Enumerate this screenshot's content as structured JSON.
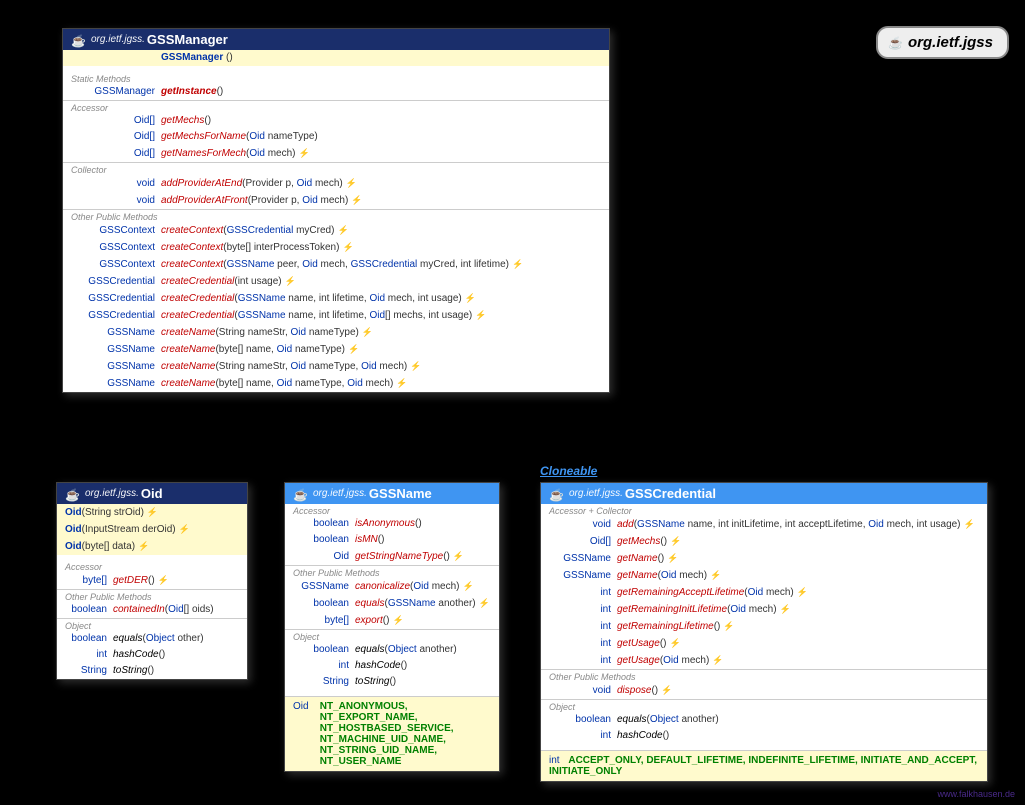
{
  "package_badge": "org.ietf.jgss",
  "footer": "www.falkhausen.de",
  "cloneable_label": "Cloneable",
  "cards": {
    "gssmanager": {
      "pkg": "org.ietf.jgss.",
      "name": "GSSManager",
      "constructor": "GSSManager",
      "sections": {
        "static": "Static Methods",
        "accessor": "Accessor",
        "collector": "Collector",
        "other": "Other Public Methods"
      },
      "static_methods": [
        {
          "ret": "GSSManager",
          "name": "getInstance",
          "args": "()"
        }
      ],
      "accessor": [
        {
          "ret": "Oid[]",
          "name": "getMechs",
          "args": "()"
        },
        {
          "ret": "Oid[]",
          "name": "getMechsForName",
          "args_pre": "(",
          "t1": "Oid",
          "a1": " nameType)",
          "args_post": ""
        },
        {
          "ret": "Oid[]",
          "name": "getNamesForMech",
          "args_pre": "(",
          "t1": "Oid",
          "a1": " mech)",
          "throws": "⚡"
        }
      ],
      "collector": [
        {
          "ret": "void",
          "name": "addProviderAtEnd",
          "html": "(Provider p, <span class='type'>Oid</span> mech)",
          "throws": "⚡"
        },
        {
          "ret": "void",
          "name": "addProviderAtFront",
          "html": "(Provider p, <span class='type'>Oid</span> mech)",
          "throws": "⚡"
        }
      ],
      "other": [
        {
          "ret": "GSSContext",
          "name": "createContext",
          "html": "(<span class='type'>GSSCredential</span> myCred)",
          "throws": "⚡"
        },
        {
          "ret": "GSSContext",
          "name": "createContext",
          "html": "(byte[] interProcessToken)",
          "throws": "⚡"
        },
        {
          "ret": "GSSContext",
          "name": "createContext",
          "html": "(<span class='type'>GSSName</span> peer, <span class='type'>Oid</span> mech, <span class='type'>GSSCredential</span> myCred, int lifetime)",
          "throws": "⚡"
        },
        {
          "ret": "GSSCredential",
          "name": "createCredential",
          "html": "(int usage)",
          "throws": "⚡"
        },
        {
          "ret": "GSSCredential",
          "name": "createCredential",
          "html": "(<span class='type'>GSSName</span> name, int lifetime, <span class='type'>Oid</span> mech, int usage)",
          "throws": "⚡"
        },
        {
          "ret": "GSSCredential",
          "name": "createCredential",
          "html": "(<span class='type'>GSSName</span> name, int lifetime, <span class='type'>Oid</span>[] mechs, int usage)",
          "throws": "⚡"
        },
        {
          "ret": "GSSName",
          "name": "createName",
          "html": "(String nameStr, <span class='type'>Oid</span> nameType)",
          "throws": "⚡"
        },
        {
          "ret": "GSSName",
          "name": "createName",
          "html": "(byte[] name, <span class='type'>Oid</span> nameType)",
          "throws": "⚡"
        },
        {
          "ret": "GSSName",
          "name": "createName",
          "html": "(String nameStr, <span class='type'>Oid</span> nameType, <span class='type'>Oid</span> mech)",
          "throws": "⚡"
        },
        {
          "ret": "GSSName",
          "name": "createName",
          "html": "(byte[] name, <span class='type'>Oid</span> nameType, <span class='type'>Oid</span> mech)",
          "throws": "⚡"
        }
      ]
    },
    "oid": {
      "pkg": "org.ietf.jgss.",
      "name": "Oid",
      "constructors": [
        {
          "name": "Oid",
          "args": "(String strOid)",
          "throws": "⚡"
        },
        {
          "name": "Oid",
          "args": "(InputStream derOid)",
          "throws": "⚡"
        },
        {
          "name": "Oid",
          "args": "(byte[] data)",
          "throws": "⚡"
        }
      ],
      "sections": {
        "accessor": "Accessor",
        "other": "Other Public Methods",
        "object": "Object"
      },
      "accessor": [
        {
          "ret": "byte[]",
          "name": "getDER",
          "args": "()",
          "throws": "⚡"
        }
      ],
      "other": [
        {
          "ret": "boolean",
          "name": "containedIn",
          "html": "(<span class='type'>Oid</span>[] oids)"
        }
      ],
      "object": [
        {
          "ret": "boolean",
          "name": "equals",
          "html": "(<span class='type'>Object</span> other)"
        },
        {
          "ret": "int",
          "name": "hashCode",
          "args": "()"
        },
        {
          "ret": "String",
          "name": "toString",
          "args": "()"
        }
      ]
    },
    "gssname": {
      "pkg": "org.ietf.jgss.",
      "name": "GSSName",
      "sections": {
        "accessor": "Accessor",
        "other": "Other Public Methods",
        "object": "Object"
      },
      "accessor": [
        {
          "ret": "boolean",
          "name": "isAnonymous",
          "args": "()"
        },
        {
          "ret": "boolean",
          "name": "isMN",
          "args": "()"
        },
        {
          "ret": "Oid",
          "name": "getStringNameType",
          "args": "()",
          "throws": "⚡"
        }
      ],
      "other": [
        {
          "ret": "GSSName",
          "name": "canonicalize",
          "html": "(<span class='type'>Oid</span> mech)",
          "throws": "⚡"
        },
        {
          "ret": "boolean",
          "name": "equals",
          "html": "(<span class='type'>GSSName</span> another)",
          "throws": "⚡"
        },
        {
          "ret": "byte[]",
          "name": "export",
          "args": "()",
          "throws": "⚡"
        }
      ],
      "object": [
        {
          "ret": "boolean",
          "name": "equals",
          "html": "(<span class='type'>Object</span> another)"
        },
        {
          "ret": "int",
          "name": "hashCode",
          "args": "()"
        },
        {
          "ret": "String",
          "name": "toString",
          "args": "()"
        }
      ],
      "const_ret": "Oid",
      "constants": "NT_ANONYMOUS,<br>NT_EXPORT_NAME,<br>NT_HOSTBASED_SERVICE,<br>NT_MACHINE_UID_NAME,<br>NT_STRING_UID_NAME,<br>NT_USER_NAME"
    },
    "gsscred": {
      "pkg": "org.ietf.jgss.",
      "name": "GSSCredential",
      "sections": {
        "ac": "Accessor + Collector",
        "other": "Other Public Methods",
        "object": "Object"
      },
      "ac": [
        {
          "ret": "void",
          "name": "add",
          "html": "(<span class='type'>GSSName</span> name, int initLifetime, int acceptLifetime, <span class='type'>Oid</span> mech, int usage)",
          "throws": "⚡"
        },
        {
          "ret": "Oid[]",
          "name": "getMechs",
          "args": "()",
          "throws": "⚡"
        },
        {
          "ret": "GSSName",
          "name": "getName",
          "args": "()",
          "throws": "⚡"
        },
        {
          "ret": "GSSName",
          "name": "getName",
          "html": "(<span class='type'>Oid</span> mech)",
          "throws": "⚡"
        },
        {
          "ret": "int",
          "name": "getRemainingAcceptLifetime",
          "html": "(<span class='type'>Oid</span> mech)",
          "throws": "⚡"
        },
        {
          "ret": "int",
          "name": "getRemainingInitLifetime",
          "html": "(<span class='type'>Oid</span> mech)",
          "throws": "⚡"
        },
        {
          "ret": "int",
          "name": "getRemainingLifetime",
          "args": "()",
          "throws": "⚡"
        },
        {
          "ret": "int",
          "name": "getUsage",
          "args": "()",
          "throws": "⚡"
        },
        {
          "ret": "int",
          "name": "getUsage",
          "html": "(<span class='type'>Oid</span> mech)",
          "throws": "⚡"
        }
      ],
      "other": [
        {
          "ret": "void",
          "name": "dispose",
          "args": "()",
          "throws": "⚡"
        }
      ],
      "object": [
        {
          "ret": "boolean",
          "name": "equals",
          "html": "(<span class='type'>Object</span> another)"
        },
        {
          "ret": "int",
          "name": "hashCode",
          "args": "()"
        }
      ],
      "const_ret": "int",
      "constants": "ACCEPT_ONLY, DEFAULT_LIFETIME, INDEFINITE_LIFETIME, INITIATE_AND_ACCEPT,<br>INITIATE_ONLY"
    }
  }
}
